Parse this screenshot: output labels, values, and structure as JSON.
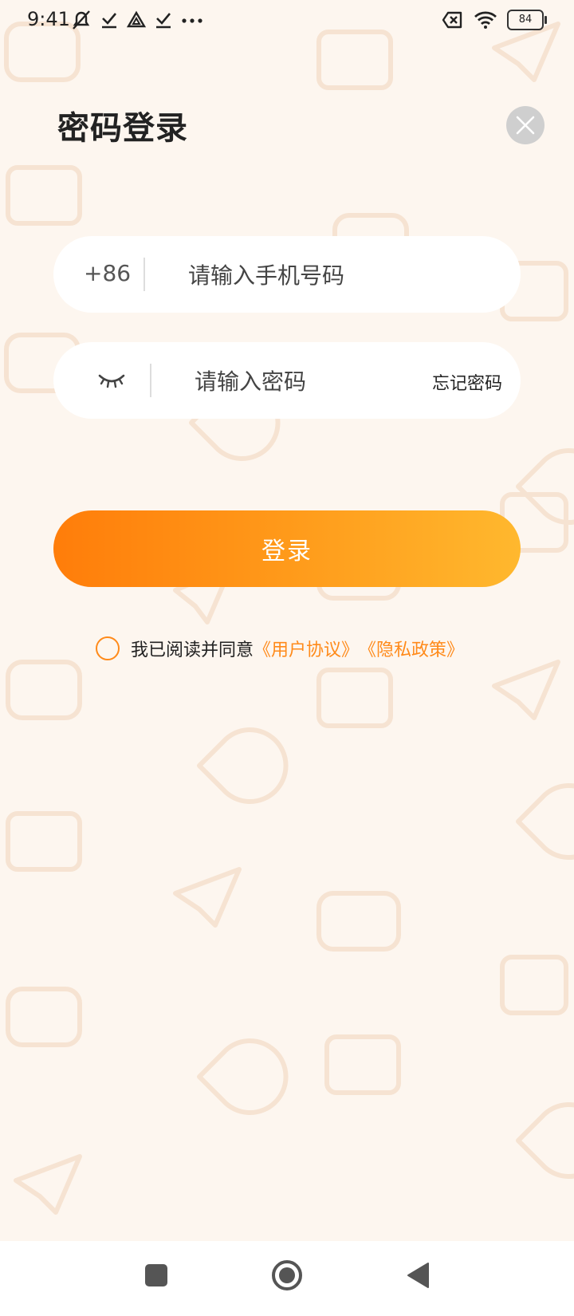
{
  "status_bar": {
    "time": "9:41",
    "battery": "84"
  },
  "page": {
    "title": "密码登录"
  },
  "phone_field": {
    "country_code": "+86",
    "placeholder": "请输入手机号码"
  },
  "password_field": {
    "placeholder": "请输入密码",
    "forgot_label": "忘记密码"
  },
  "login_button": {
    "label": "登录"
  },
  "agreement": {
    "text": "我已阅读并同意",
    "user_agreement": "《用户协议》",
    "privacy_policy": "《隐私政策》"
  },
  "colors": {
    "accent": "#ff8a1a",
    "background": "#fdf6ef",
    "gradient_start": "#ff7d0a",
    "gradient_end": "#ffb82e"
  }
}
